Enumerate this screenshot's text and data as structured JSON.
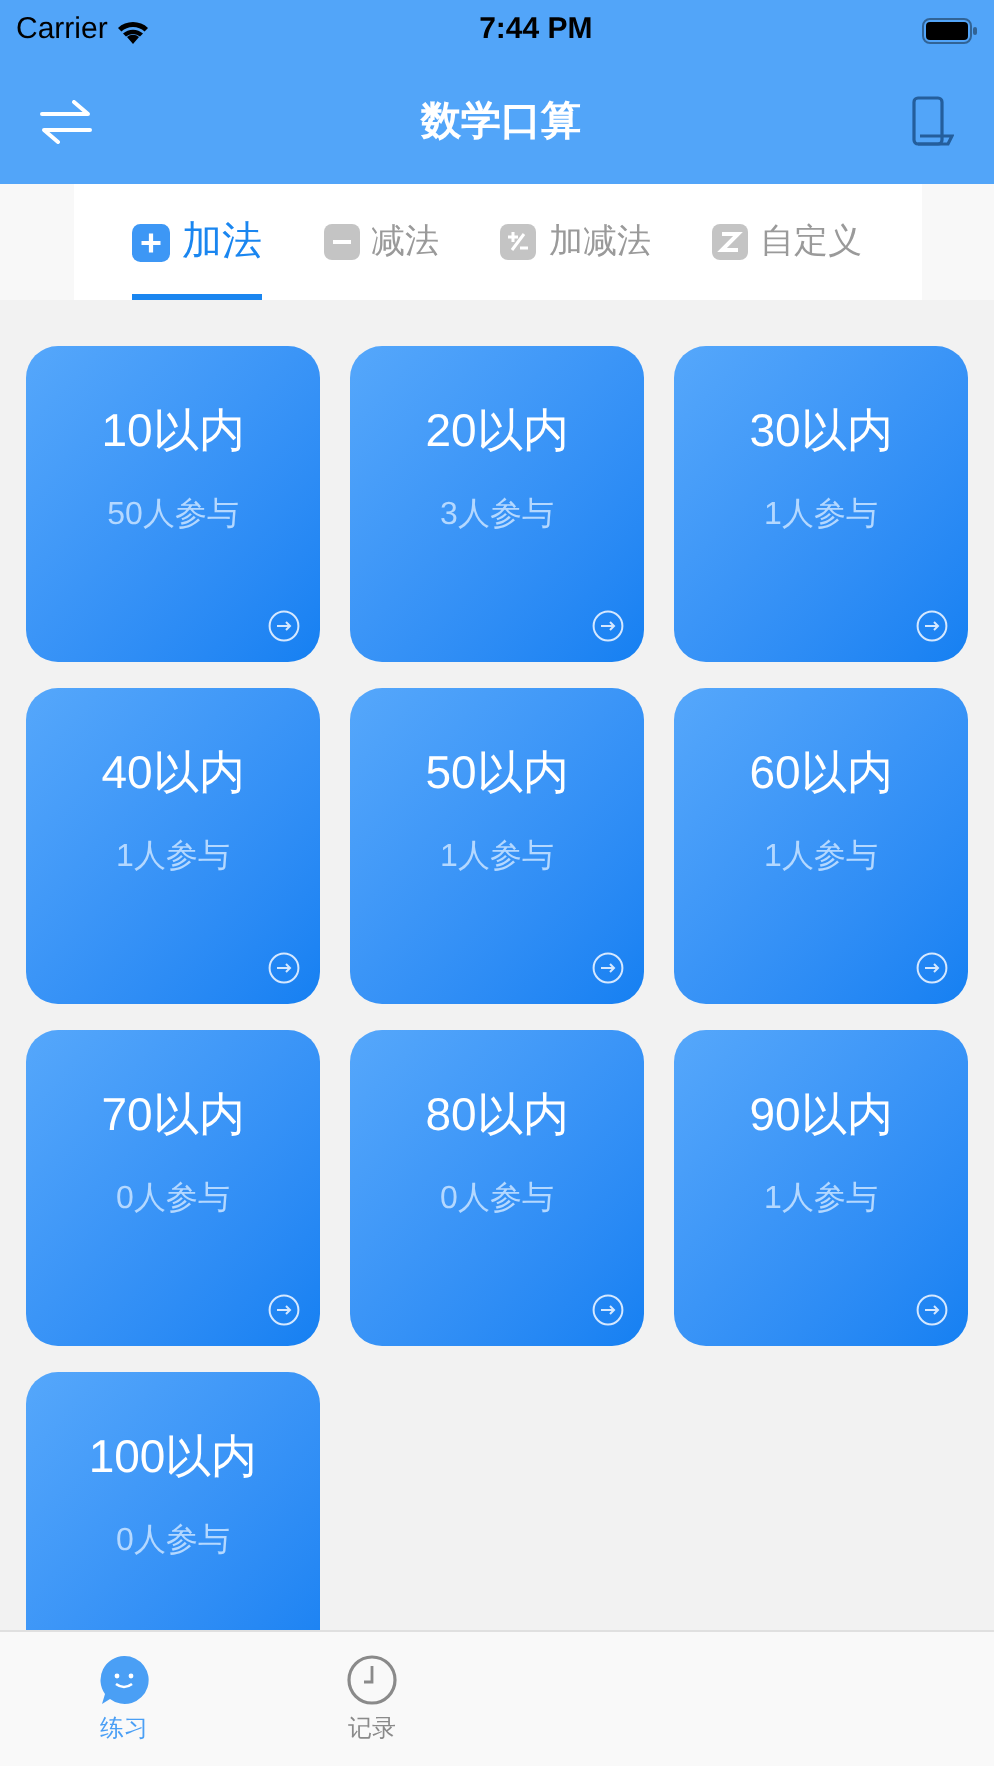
{
  "status_bar": {
    "carrier": "Carrier",
    "time": "7:44 PM"
  },
  "nav_bar": {
    "title": "数学口算"
  },
  "tabs": [
    {
      "label": "加法",
      "kind": "plus",
      "selected": true
    },
    {
      "label": "减法",
      "kind": "minus",
      "selected": false
    },
    {
      "label": "加减法",
      "kind": "mixed",
      "selected": false
    },
    {
      "label": "自定义",
      "kind": "custom",
      "selected": false
    }
  ],
  "cards": [
    {
      "title": "10以内",
      "participants": "50人参与"
    },
    {
      "title": "20以内",
      "participants": "3人参与"
    },
    {
      "title": "30以内",
      "participants": "1人参与"
    },
    {
      "title": "40以内",
      "participants": "1人参与"
    },
    {
      "title": "50以内",
      "participants": "1人参与"
    },
    {
      "title": "60以内",
      "participants": "1人参与"
    },
    {
      "title": "70以内",
      "participants": "0人参与"
    },
    {
      "title": "80以内",
      "participants": "0人参与"
    },
    {
      "title": "90以内",
      "participants": "1人参与"
    },
    {
      "title": "100以内",
      "participants": "0人参与"
    }
  ],
  "tab_bar": [
    {
      "label": "练习",
      "kind": "practice",
      "selected": true
    },
    {
      "label": "记录",
      "kind": "records",
      "selected": false
    }
  ]
}
